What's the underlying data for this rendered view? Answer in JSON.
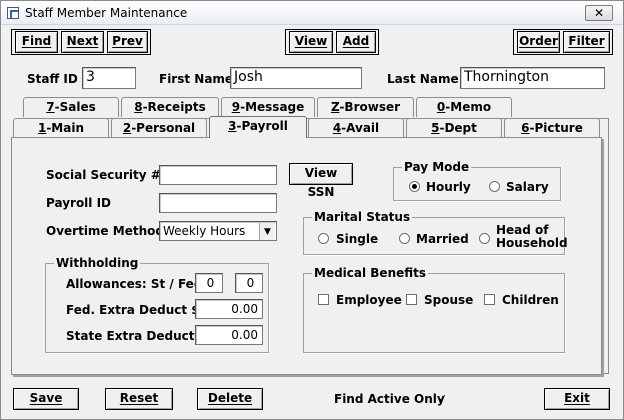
{
  "window": {
    "title": "Staff Member Maintenance",
    "close_glyph": "✕"
  },
  "toolbar": {
    "find": "Find",
    "next": "Next",
    "prev": "Prev",
    "view": "View",
    "add": "Add",
    "order": "Order",
    "filter": "Filter"
  },
  "header": {
    "staff_id_label": "Staff ID",
    "staff_id": "3",
    "first_name_label": "First Name",
    "first_name": "Josh",
    "last_name_label": "Last Name",
    "last_name": "Thornington"
  },
  "tabs_back": [
    {
      "num": "7",
      "label": "-Sales"
    },
    {
      "num": "8",
      "label": "-Receipts"
    },
    {
      "num": "9",
      "label": "-Message"
    },
    {
      "num": "Z",
      "label": "-Browser"
    },
    {
      "num": "0",
      "label": "-Memo"
    }
  ],
  "tabs_front": [
    {
      "num": "1",
      "label": "-Main"
    },
    {
      "num": "2",
      "label": "-Personal"
    },
    {
      "num": "3",
      "label": "-Payroll"
    },
    {
      "num": "4",
      "label": "-Avail"
    },
    {
      "num": "5",
      "label": "-Dept"
    },
    {
      "num": "6",
      "label": "-Picture"
    }
  ],
  "payroll": {
    "ssn_label": "Social Security #",
    "ssn": "",
    "view_ssn": "View SSN",
    "payroll_id_label": "Payroll ID",
    "payroll_id": "",
    "overtime_label": "Overtime Method",
    "overtime_value": "Weekly Hours",
    "withholding": {
      "title": "Withholding",
      "allowances_label": "Allowances: St / Fed",
      "st_allowance": "0",
      "fed_allowance": "0",
      "fed_extra_label": "Fed.  Extra Deduct $",
      "fed_extra": "0.00",
      "state_extra_label": "State Extra Deduct $",
      "state_extra": "0.00"
    },
    "pay_mode": {
      "title": "Pay Mode",
      "hourly": "Hourly",
      "salary": "Salary",
      "selected": "Hourly"
    },
    "marital": {
      "title": "Marital Status",
      "single": "Single",
      "married": "Married",
      "head1": "Head of",
      "head2": "Household"
    },
    "medical": {
      "title": "Medical Benefits",
      "employee": "Employee",
      "spouse": "Spouse",
      "children": "Children"
    }
  },
  "footer": {
    "save": "Save",
    "reset": "Reset",
    "delete": "Delete",
    "find_active_label": "Find Active Only",
    "find_active_checked": true,
    "exit": "Exit"
  }
}
